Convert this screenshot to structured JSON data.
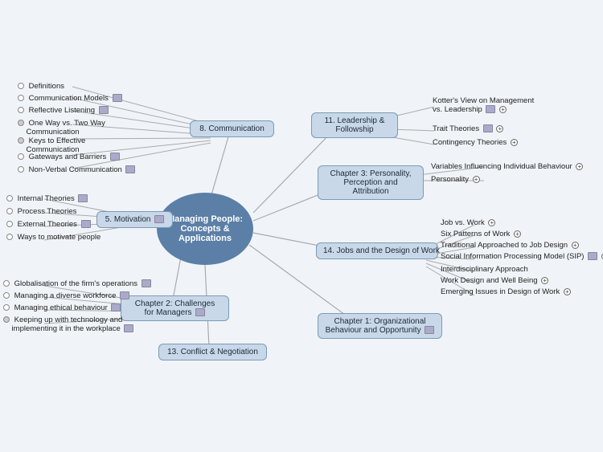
{
  "title": "Managing People: Concepts & Applications",
  "center": {
    "label": "Managing People:\nConcepts &\nApplications"
  },
  "nodes": {
    "communication": {
      "label": "8. Communication"
    },
    "motivation": {
      "label": "5. Motivation"
    },
    "challenges": {
      "label": "Chapter 2: Challenges\nfor Managers"
    },
    "org_behaviour": {
      "label": "Chapter 1: Organizational\nBehaviour and Opportunity"
    },
    "conflict": {
      "label": "13. Conflict & Negotiation"
    },
    "jobs": {
      "label": "14. Jobs and the Design of Work"
    },
    "personality": {
      "label": "Chapter 3: Personality,\nPerception and Attribution"
    },
    "leadership": {
      "label": "11. Leadership &\nFollowship"
    }
  },
  "leaves": {
    "comm_leaves": [
      "Definitions",
      "Communication Models",
      "Reflective Listening",
      "One Way vs. Two Way\nCommunication",
      "Keys to Effective\nCommunication",
      "Gateways and Barriers",
      "Non-Verbal Communication"
    ],
    "motivation_leaves": [
      "Internal Theories",
      "Process Theories",
      "External Theories",
      "Ways to motivate people"
    ],
    "challenges_leaves": [
      "Globalisation of the firm's operations",
      "Managing a diverse workforce",
      "Managing ethical behaviour",
      "Keeping up with technology and\nimplementing it in the workplace"
    ],
    "leadership_leaves": [
      "Kotter's View on Management\nvs. Leadership",
      "Trait Theories",
      "Contingency Theories"
    ],
    "personality_leaves": [
      "Variables Influencing Individual Behaviour",
      "Personality"
    ],
    "jobs_leaves": [
      "Job vs. Work",
      "Six Patterns of Work",
      "Traditional Approached to Job Design",
      "Social Information Processing Model (SIP)",
      "Interdisciplinary Approach",
      "Work Design and Well Being",
      "Emerging Issues in Design of Work"
    ]
  }
}
